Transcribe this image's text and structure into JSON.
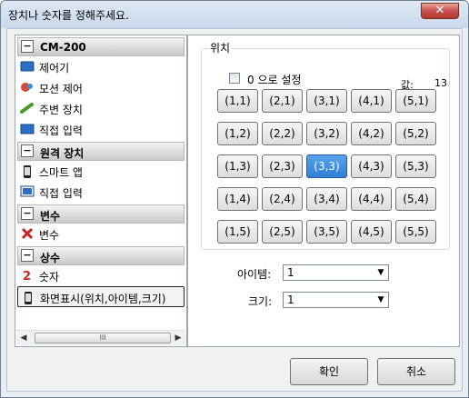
{
  "window": {
    "title": "장치나 숫자를 정해주세요.",
    "close_label": "✕"
  },
  "tree": {
    "groups": [
      {
        "label": "CM-200",
        "items": [
          {
            "label": "제어기",
            "icon": "controller-icon"
          },
          {
            "label": "모션 제어",
            "icon": "motion-icon"
          },
          {
            "label": "주변 장치",
            "icon": "peripheral-icon"
          },
          {
            "label": "직접 입력",
            "icon": "monitor-icon"
          }
        ]
      },
      {
        "label": "원격 장치",
        "items": [
          {
            "label": "스마트 앱",
            "icon": "smartphone-icon"
          },
          {
            "label": "직접 입력",
            "icon": "screen-input-icon"
          }
        ]
      },
      {
        "label": "변수",
        "items": [
          {
            "label": "변수",
            "icon": "variable-icon"
          }
        ]
      },
      {
        "label": "상수",
        "items": [
          {
            "label": "숫자",
            "icon": "number-icon"
          },
          {
            "label": "화면표시(위치,아이템,크기)",
            "icon": "smartphone-icon",
            "selected": true
          }
        ]
      }
    ],
    "scroll_thumb": "III",
    "scroll_left": "◀",
    "scroll_right": "▶"
  },
  "position": {
    "group_title": "위치",
    "zero_checkbox_label": "0 으로 설정",
    "zero_checked": false,
    "value_label": "값:",
    "value": "13",
    "grid": [
      [
        "(1,1)",
        "(2,1)",
        "(3,1)",
        "(4,1)",
        "(5,1)"
      ],
      [
        "(1,2)",
        "(2,2)",
        "(3,2)",
        "(4,2)",
        "(5,2)"
      ],
      [
        "(1,3)",
        "(2,3)",
        "(3,3)",
        "(4,3)",
        "(5,3)"
      ],
      [
        "(1,4)",
        "(2,4)",
        "(3,4)",
        "(4,4)",
        "(5,4)"
      ],
      [
        "(1,5)",
        "(2,5)",
        "(3,5)",
        "(4,5)",
        "(5,5)"
      ]
    ],
    "selected": "(3,3)"
  },
  "item_field": {
    "label": "아이템:",
    "value": "1",
    "arrow": "▼"
  },
  "size_field": {
    "label": "크기:",
    "value": "1",
    "arrow": "▼"
  },
  "footer": {
    "ok_label": "확인",
    "cancel_label": "취소"
  },
  "colors": {
    "selected_accent": "#2f7fd6"
  }
}
